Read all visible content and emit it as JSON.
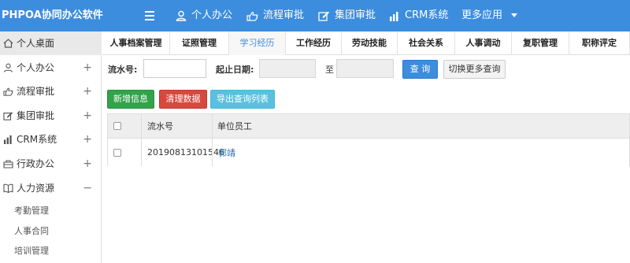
{
  "app": {
    "title": "PHPOA协同办公软件"
  },
  "topnav": {
    "items": [
      {
        "label": "个人办公",
        "icon": "user-icon"
      },
      {
        "label": "流程审批",
        "icon": "hand-icon"
      },
      {
        "label": "集团审批",
        "icon": "edit-icon"
      },
      {
        "label": "CRM系统",
        "icon": "bar-chart-icon"
      }
    ],
    "more_label": "更多应用"
  },
  "sidebar": {
    "items": [
      {
        "label": "个人桌面",
        "icon": "home-icon",
        "toggle": ""
      },
      {
        "label": "个人办公",
        "icon": "user-icon",
        "toggle": "+"
      },
      {
        "label": "流程审批",
        "icon": "hand-icon",
        "toggle": "+"
      },
      {
        "label": "集团审批",
        "icon": "edit-icon",
        "toggle": "+"
      },
      {
        "label": "CRM系统",
        "icon": "bar-chart-icon",
        "toggle": "+"
      },
      {
        "label": "行政办公",
        "icon": "building-icon",
        "toggle": "+"
      },
      {
        "label": "人力资源",
        "icon": "book-icon",
        "toggle": "−"
      }
    ],
    "subitems": [
      "考勤管理",
      "人事合同",
      "培训管理"
    ]
  },
  "tabs": [
    "人事档案管理",
    "证照管理",
    "学习经历",
    "工作经历",
    "劳动技能",
    "社会关系",
    "人事调动",
    "复职管理",
    "职称评定"
  ],
  "search": {
    "serial_label": "流水号:",
    "serial_value": "",
    "date_label": "起止日期:",
    "date_start": "",
    "to_label": "至",
    "date_end": "",
    "query_button": "查 询",
    "more_button": "切换更多查询"
  },
  "actions": {
    "add": "新增信息",
    "clear": "清理数据",
    "export": "导出查询列表"
  },
  "table": {
    "headers": [
      "流水号",
      "单位员工"
    ],
    "rows": [
      {
        "serial": "20190813101546",
        "employee": "郭靖"
      }
    ]
  },
  "colors": {
    "primary": "#3c8dde",
    "success": "#32a34a",
    "danger": "#d9473d",
    "info": "#5bc0de"
  }
}
